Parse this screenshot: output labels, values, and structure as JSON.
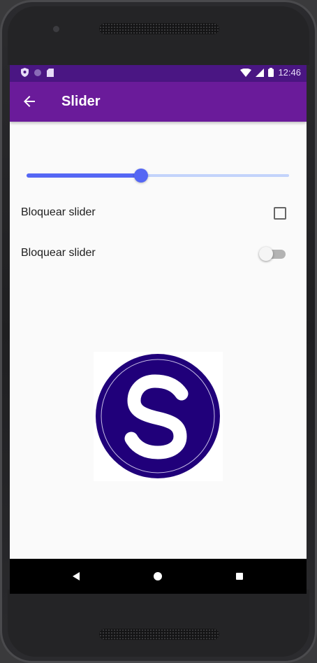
{
  "status_bar": {
    "time": "12:46",
    "icons": [
      "shield-icon",
      "circle-icon",
      "sd-card-icon",
      "wifi-icon",
      "signal-icon",
      "battery-icon"
    ]
  },
  "app_bar": {
    "title": "Slider",
    "back_icon": "arrow-back-icon"
  },
  "slider": {
    "value_fraction": 0.435
  },
  "options": [
    {
      "label": "Bloquear slider",
      "control": "checkbox",
      "checked": false
    },
    {
      "label": "Bloquear slider",
      "control": "switch",
      "on": false
    }
  ],
  "logo": {
    "letter": "S",
    "circle_color": "#20007a",
    "letter_color": "#ffffff"
  },
  "nav_bar": {
    "buttons": [
      "back-triangle-icon",
      "home-circle-icon",
      "recents-square-icon"
    ]
  },
  "colors": {
    "status_bar": "#4a1683",
    "app_bar": "#6a1b9a",
    "slider_active": "#5567f4",
    "slider_inactive": "#c3d3fb"
  }
}
